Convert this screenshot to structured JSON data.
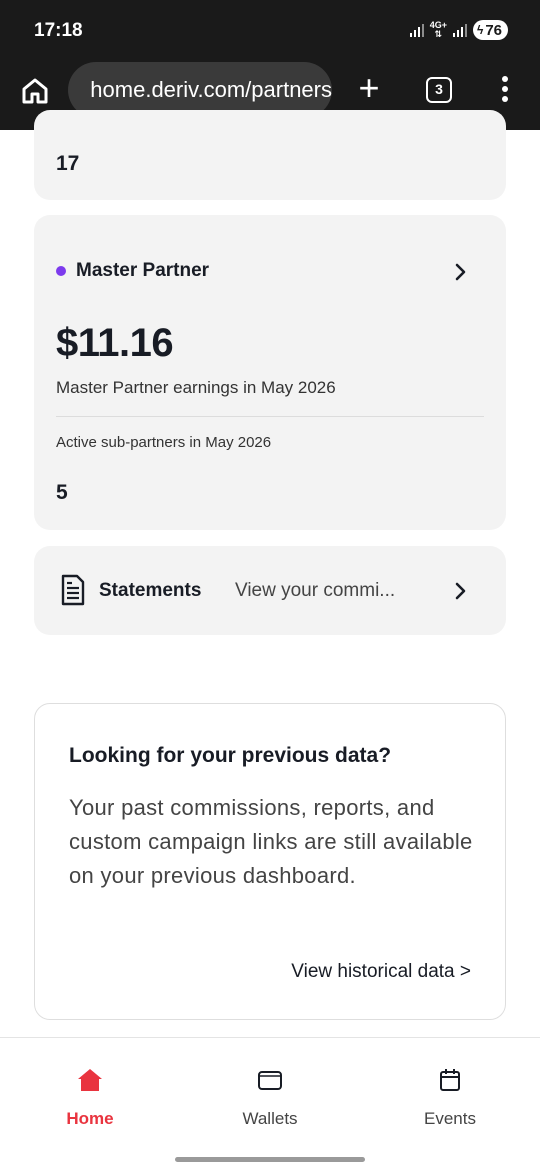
{
  "status_bar": {
    "time": "17:18",
    "network": "4G+",
    "battery": "76"
  },
  "browser": {
    "url": "home.deriv.com/partners",
    "tab_count": "3"
  },
  "top_card": {
    "value": "17"
  },
  "master_partner": {
    "title": "Master Partner",
    "amount": "$11.16",
    "earnings_label": "Master Partner earnings in May 2026",
    "sub_partners_label": "Active sub-partners in May 2026",
    "sub_partners_value": "5",
    "dot_color": "#7c3aed"
  },
  "statements": {
    "title": "Statements",
    "description": "View your commi..."
  },
  "previous_data": {
    "title": "Looking for your previous data?",
    "body": "Your past commissions, reports, and custom campaign links are still available on your previous dashboard.",
    "link": "View historical data >"
  },
  "bottom_nav": {
    "items": [
      {
        "label": "Home",
        "icon": "home-icon",
        "active": true
      },
      {
        "label": "Wallets",
        "icon": "wallet-icon",
        "active": false
      },
      {
        "label": "Events",
        "icon": "calendar-icon",
        "active": false
      }
    ],
    "active_color": "#e9343f"
  }
}
